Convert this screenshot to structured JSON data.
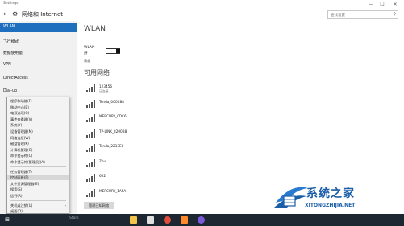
{
  "window": {
    "app_title": "Settings",
    "min_glyph": "—",
    "max_glyph": "☐",
    "close_glyph": "✕"
  },
  "header": {
    "back_glyph": "←",
    "gear_glyph": "⚙",
    "title": "网络和 Internet",
    "search_placeholder": "查找设置",
    "search_glyph": "⚲"
  },
  "sidebar": {
    "items": [
      {
        "label": "WLAN",
        "active": true
      },
      {
        "label": "飞行模式"
      },
      {
        "label": "数据使用量"
      },
      {
        "label": "VPN"
      },
      {
        "label": "DirectAccess"
      },
      {
        "label": "Dial-up"
      }
    ]
  },
  "context_menu": {
    "items": [
      "程序和功能(F)",
      "移动中心(B)",
      "电源选项(O)",
      "事件查看器(V)",
      "系统(Y)",
      "设备管理器(M)",
      "网络连接(W)",
      "磁盘管理(K)",
      "计算机管理(G)",
      "命令提示符(C)",
      "命令提示符(管理员)(A)",
      "任务管理器(T)",
      "控制面板(P)",
      "文件资源管理器(E)",
      "搜索(S)",
      "运行(R)",
      "关机或注销(U)",
      "桌面(D)"
    ],
    "highlighted": "控制面板(P)",
    "submenu_arrow": "›"
  },
  "content": {
    "section_title": "WLAN",
    "wlan_label": "WLAN",
    "wlan_state": "开",
    "advanced_link": "高级",
    "available_title": "可用网络",
    "networks": [
      {
        "name": "123456",
        "status": "已连接"
      },
      {
        "name": "Tenda_0C0C88",
        "status": ""
      },
      {
        "name": "MERCURY_0DC6",
        "status": ""
      },
      {
        "name": "TP-LINK_8200B8",
        "status": ""
      },
      {
        "name": "Tenda_2213E0",
        "status": ""
      },
      {
        "name": "Zhu",
        "status": ""
      },
      {
        "name": "602",
        "status": ""
      },
      {
        "name": "MERCURY_1A5A",
        "status": ""
      }
    ],
    "manage_button": "管理已知网络"
  },
  "taskbar": {
    "start_glyph": "⊞",
    "search_text": "Stars",
    "icons": [
      {
        "name": "explorer",
        "color": "#f2c54a"
      },
      {
        "name": "store",
        "color": "#e0e0e0"
      },
      {
        "name": "chrome",
        "color": "#e44d3a"
      },
      {
        "name": "media",
        "color": "#ff8a2a"
      },
      {
        "name": "app",
        "color": "#7a5ad8"
      }
    ]
  },
  "watermark": {
    "text": "系统之家",
    "url": "XITONGZHIJIA.NET"
  },
  "colors": {
    "accent": "#1e6fbd",
    "taskbar": "#1d2731",
    "watermark": "#1a5ea8"
  }
}
